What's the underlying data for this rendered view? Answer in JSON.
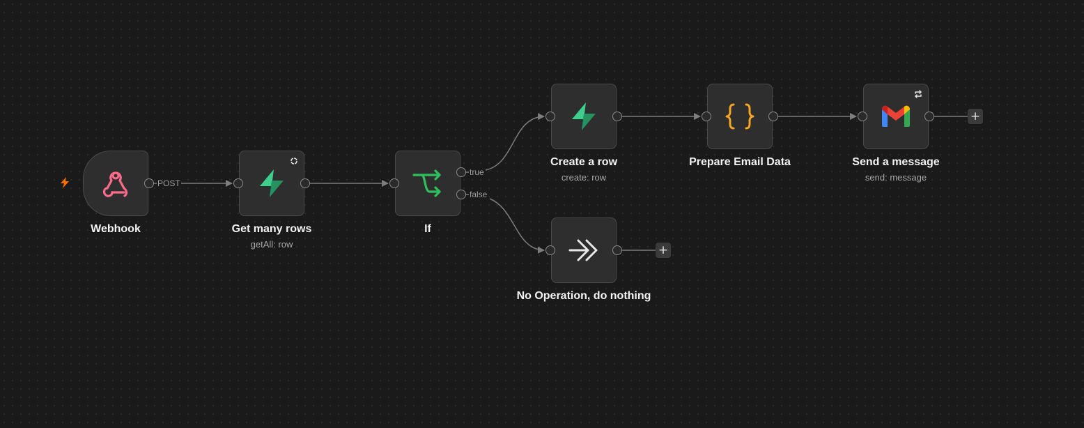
{
  "nodes": {
    "webhook": {
      "title": "Webhook",
      "output_label": "POST",
      "icon": "webhook-icon",
      "icon_color": "#ff6b8a"
    },
    "get_many_rows": {
      "title": "Get many rows",
      "subtitle": "getAll: row",
      "icon": "supabase-icon",
      "badge": "refresh-icon"
    },
    "if": {
      "title": "If",
      "true_label": "true",
      "false_label": "false",
      "icon": "if-branch-icon",
      "icon_color": "#2ec05c"
    },
    "create_row": {
      "title": "Create a row",
      "subtitle": "create: row",
      "icon": "supabase-icon"
    },
    "prepare_email": {
      "title": "Prepare Email Data",
      "icon": "code-braces-icon",
      "icon_color": "#f5a623"
    },
    "send_message": {
      "title": "Send a message",
      "subtitle": "send: message",
      "icon": "gmail-icon",
      "badge": "sync-icon"
    },
    "no_op": {
      "title": "No Operation, do nothing",
      "icon": "chevrons-right-icon"
    }
  },
  "add_button_label": "+",
  "colors": {
    "canvas_bg": "#1a1a1a",
    "node_bg": "#2e2e2e",
    "node_border": "#4a4a4a",
    "edge": "#7d7d7d",
    "supabase_green": "#3ecf8e",
    "trigger_orange": "#ff6d00"
  }
}
